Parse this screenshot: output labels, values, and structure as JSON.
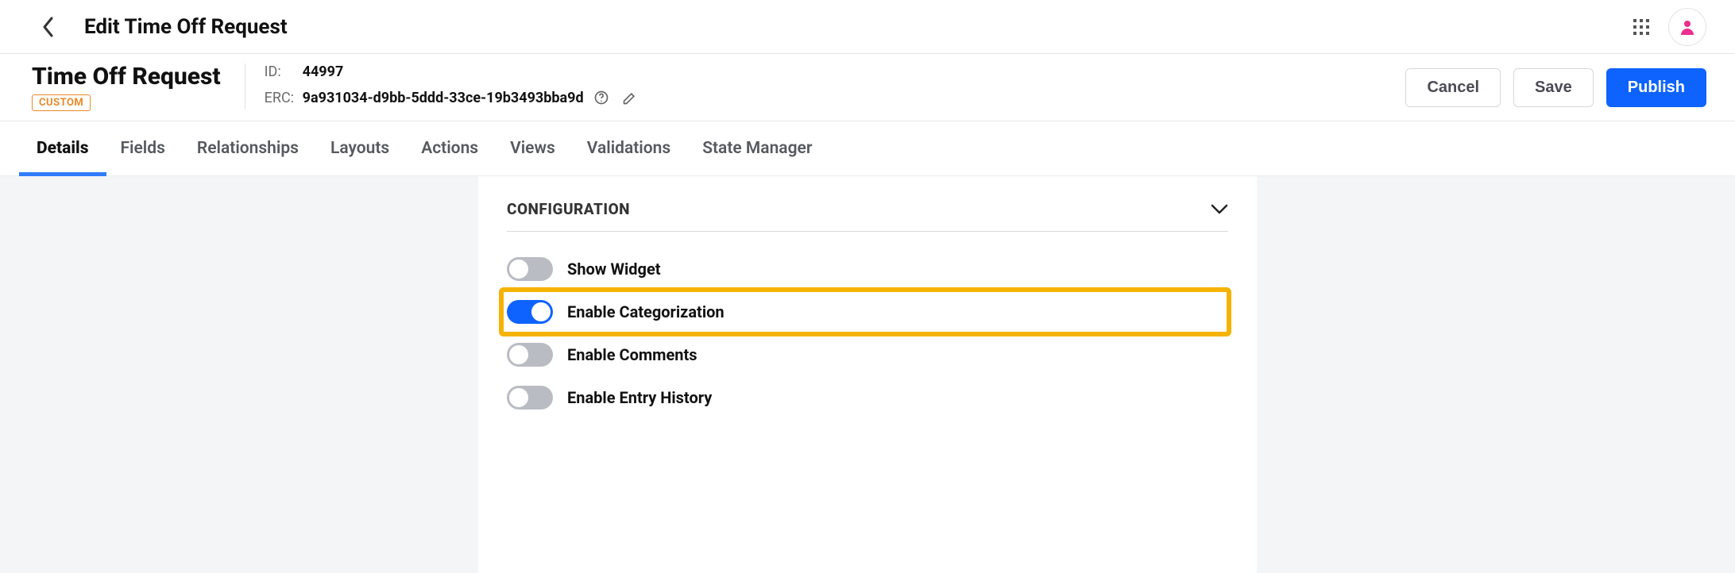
{
  "topbar": {
    "title": "Edit Time Off Request"
  },
  "entity": {
    "name": "Time Off Request",
    "badge": "CUSTOM",
    "id_label": "ID:",
    "id_value": "44997",
    "erc_label": "ERC:",
    "erc_value": "9a931034-d9bb-5ddd-33ce-19b3493bba9d"
  },
  "buttons": {
    "cancel": "Cancel",
    "save": "Save",
    "publish": "Publish"
  },
  "tabs": [
    {
      "label": "Details",
      "active": true
    },
    {
      "label": "Fields",
      "active": false
    },
    {
      "label": "Relationships",
      "active": false
    },
    {
      "label": "Layouts",
      "active": false
    },
    {
      "label": "Actions",
      "active": false
    },
    {
      "label": "Views",
      "active": false
    },
    {
      "label": "Validations",
      "active": false
    },
    {
      "label": "State Manager",
      "active": false
    }
  ],
  "section": {
    "title": "CONFIGURATION"
  },
  "toggles": [
    {
      "label": "Show Widget",
      "on": false,
      "highlight": false
    },
    {
      "label": "Enable Categorization",
      "on": true,
      "highlight": true
    },
    {
      "label": "Enable Comments",
      "on": false,
      "highlight": false
    },
    {
      "label": "Enable Entry History",
      "on": false,
      "highlight": false
    }
  ]
}
